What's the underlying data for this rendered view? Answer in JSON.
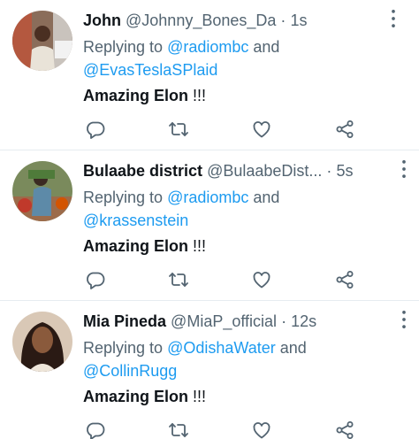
{
  "tweets": [
    {
      "name": "John",
      "handle": "@Johnny_Bones_Da",
      "dot": "·",
      "time": "1s",
      "replying_prefix": "Replying to",
      "mention_1": "@radiombc",
      "and": "and",
      "mention_2": "@EvasTeslaSPlaid",
      "text_bold": "Amazing Elon",
      "text_tail": "!!!"
    },
    {
      "name": "Bulaabe district",
      "handle": "@BulaabeDist...",
      "dot": "·",
      "time": "5s",
      "replying_prefix": "Replying to",
      "mention_1": "@radiombc",
      "and": "and",
      "mention_2": "@krassenstein",
      "text_bold": "Amazing Elon",
      "text_tail": "!!!"
    },
    {
      "name": "Mia Pineda",
      "handle": "@MiaP_official",
      "dot": "·",
      "time": "12s",
      "replying_prefix": "Replying to",
      "mention_1": "@OdishaWater",
      "and": "and",
      "mention_2": "@CollinRugg",
      "text_bold": "Amazing Elon",
      "text_tail": "!!!"
    }
  ],
  "icons": {
    "more": "more-icon",
    "reply": "reply-icon",
    "retweet": "retweet-icon",
    "like": "heart-icon",
    "share": "share-icon"
  },
  "colors": {
    "text": "#0f1419",
    "secondary": "#536471",
    "link": "#1d9bf0",
    "divider": "#e6ecf0"
  }
}
